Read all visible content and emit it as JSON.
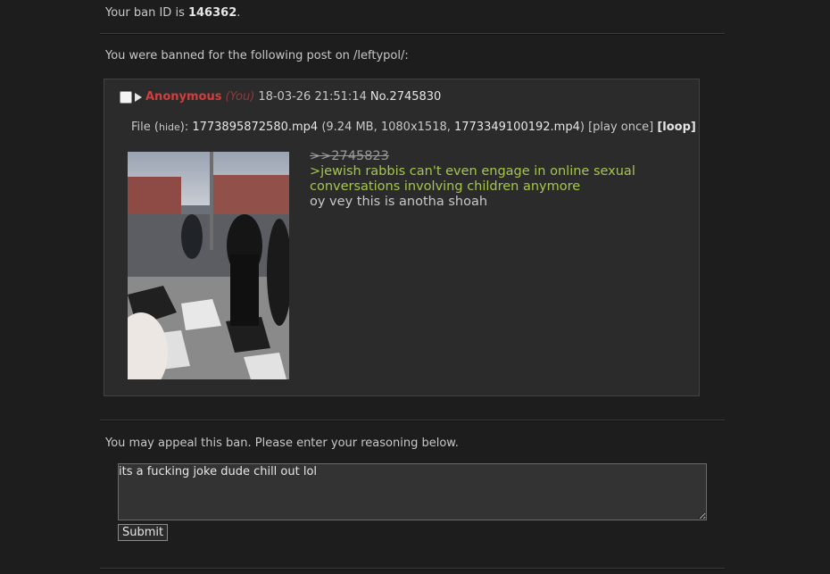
{
  "ban": {
    "id_prefix": "Your ban ID is ",
    "id": "146362",
    "id_suffix": "."
  },
  "banned_for": "You were banned for the following post on /leftypol/:",
  "post": {
    "name": "Anonymous",
    "you_tag": "(You)",
    "date": "18-03-26 21:51:14",
    "number": "No.2745830",
    "file": {
      "label": "File ",
      "hide_open": "(",
      "hide": "hide",
      "hide_close": "): ",
      "filename": "1773895872580.mp4",
      "meta_open": " (9.24 MB, 1080x1518, ",
      "original_name": "1773349100192.mp4",
      "meta_close": ") ",
      "play_once": "[play once]",
      "loop": "[loop]"
    },
    "body": {
      "quote_link": ">>2745823",
      "greentext": ">jewish rabbis can't even engage in online sexual conversations involving children anymore",
      "text": "oy vey this is anotha shoah"
    }
  },
  "appeal": {
    "prompt": "You may appeal this ban. Please enter your reasoning below.",
    "text": "its a fucking joke dude chill out lol",
    "submit_label": "Submit"
  },
  "icons": {
    "checkbox": "checkbox-icon",
    "expand": "triangle-right-icon"
  }
}
